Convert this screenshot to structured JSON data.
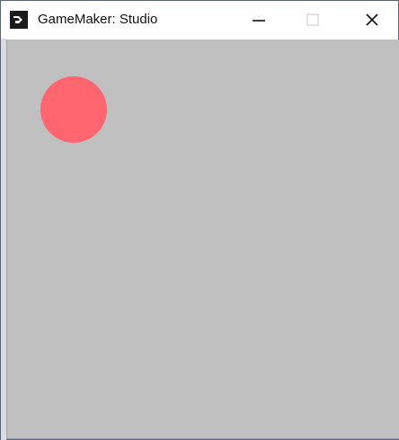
{
  "window": {
    "title": "GameMaker: Studio",
    "app_icon": "gamemaker-icon",
    "controls": {
      "minimize_icon": "minimize-icon",
      "maximize_icon": "maximize-icon",
      "close_icon": "close-icon"
    }
  },
  "game": {
    "background_color": "#c0c0c0",
    "ball_color": "#ff6670"
  }
}
